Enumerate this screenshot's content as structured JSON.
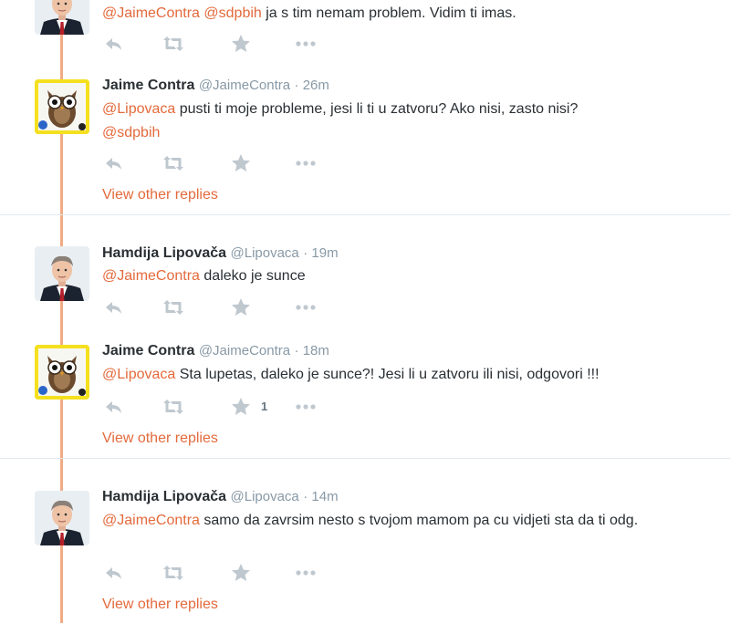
{
  "colors": {
    "link": "#e36a3c",
    "thread": "#f0ab85",
    "muted": "#8899a6",
    "icon": "#bfc8cf"
  },
  "tweets": [
    {
      "mention1": "@JaimeContra",
      "mention2": "@sdpbih",
      "text": " ja s tim nemam problem. Vidim ti imas."
    },
    {
      "name": "Jaime Contra",
      "handle": "@JaimeContra",
      "time": "· 26m",
      "mention1": "@Lipovaca",
      "text": " pusti ti moje probleme, jesi li ti u zatvoru?  Ako nisi, zasto nisi?",
      "mention2": "@sdpbih",
      "view_replies": "View other replies"
    },
    {
      "name": "Hamdija Lipovača",
      "handle": "@Lipovaca",
      "time": "· 19m",
      "mention1": "@JaimeContra",
      "text": " daleko je sunce"
    },
    {
      "name": "Jaime Contra",
      "handle": "@JaimeContra",
      "time": "· 18m",
      "mention1": "@Lipovaca",
      "text": " Sta lupetas, daleko je sunce?! Jesi li u zatvoru ili nisi, odgovori !!!",
      "favorites": "1",
      "view_replies": "View other replies"
    },
    {
      "name": "Hamdija Lipovača",
      "handle": "@Lipovaca",
      "time": "· 14m",
      "mention1": "@JaimeContra",
      "text": " samo da zavrsim nesto s tvojom mamom pa cu vidjeti sta da ti odg.",
      "view_replies": "View other replies"
    }
  ]
}
